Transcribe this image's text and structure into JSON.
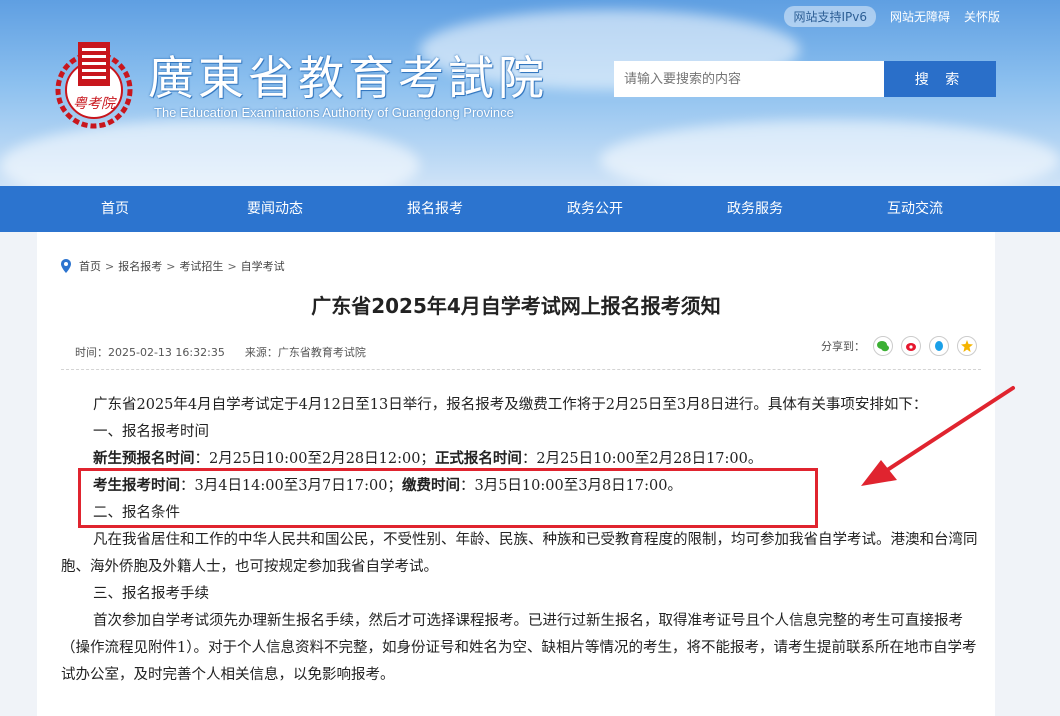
{
  "header": {
    "ipv6_badge": "网站支持IPv6",
    "accessibility_link": "网站无障碍",
    "care_link": "关怀版",
    "site_title": "廣東省教育考試院",
    "site_title_en": "The Education Examinations Authority of Guangdong Province",
    "seal_text": "粤考院",
    "search_placeholder": "请输入要搜索的内容",
    "search_button": "搜 索"
  },
  "nav": {
    "items": [
      "首页",
      "要闻动态",
      "报名报考",
      "政务公开",
      "政务服务",
      "互动交流"
    ]
  },
  "breadcrumb": [
    "首页",
    "报名报考",
    "考试招生",
    "自学考试"
  ],
  "article": {
    "title": "广东省2025年4月自学考试网上报名报考须知",
    "time": "时间：2025-02-13 16:32:35",
    "source": "来源：广东省教育考试院",
    "share_label": "分享到：",
    "intro": "广东省2025年4月自学考试定于4月12日至13日举行，报名报考及缴费工作将于2月25日至3月8日进行。具体有关事项安排如下：",
    "section1": "一、报名报考时间",
    "new_pre_label": "新生预报名时间",
    "new_pre_value": "：2月25日10:00至2月28日12:00；",
    "formal_label": "正式报名时间",
    "formal_value": "：2月25日10:00至2月28日17:00。",
    "exam_label": "考生报考时间",
    "exam_value": "：3月4日14:00至3月7日17:00；",
    "pay_label": "缴费时间",
    "pay_value": "：3月5日10:00至3月8日17:00。",
    "section2": "二、报名条件",
    "cond": "凡在我省居住和工作的中华人民共和国公民，不受性别、年龄、民族、种族和已受教育程度的限制，均可参加我省自学考试。港澳和台湾同胞、海外侨胞及外籍人士，也可按规定参加我省自学考试。",
    "section3": "三、报名报考手续",
    "procedure": "首次参加自学考试须先办理新生报名手续，然后才可选择课程报考。已进行过新生报名，取得准考证号且个人信息完整的考生可直接报考（操作流程见附件1）。对于个人信息资料不完整，如身份证号和姓名为空、缺相片等情况的考生，将不能报考，请考生提前联系所在地市自学考试办公室，及时完善个人相关信息，以免影响报考。"
  },
  "colors": {
    "nav_blue": "#2c74cf",
    "highlight_red": "#e0242f",
    "seal_red": "#c8161d"
  }
}
